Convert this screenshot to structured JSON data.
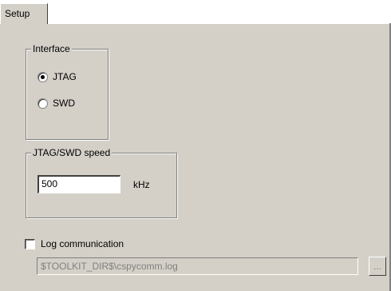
{
  "tabs": [
    {
      "label": "Setup"
    }
  ],
  "interface_group": {
    "title": "Interface",
    "options": [
      {
        "label": "JTAG",
        "checked": true
      },
      {
        "label": "SWD",
        "checked": false
      }
    ]
  },
  "speed_group": {
    "title": "JTAG/SWD speed",
    "value": "500",
    "unit": "kHz"
  },
  "log": {
    "label": "Log communication",
    "checked": false,
    "path": "$TOOLKIT_DIR$\\cspycomm.log",
    "browse_label": "..."
  }
}
